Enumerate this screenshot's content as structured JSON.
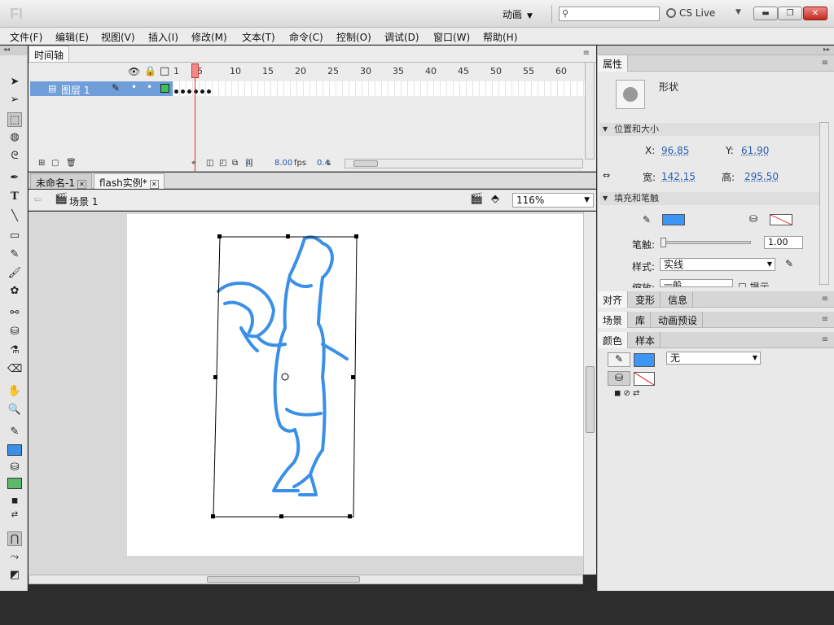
{
  "app": {
    "logo": "Fl",
    "workspace": "动画",
    "search_placeholder": "",
    "cs_live": "CS Live"
  },
  "menu": [
    "文件(F)",
    "编辑(E)",
    "视图(V)",
    "插入(I)",
    "修改(M)",
    "文本(T)",
    "命令(C)",
    "控制(O)",
    "调试(D)",
    "窗口(W)",
    "帮助(H)"
  ],
  "timeline": {
    "tab": "时间轴",
    "layer_name": "图层 1",
    "ruler": [
      "1",
      "5",
      "10",
      "15",
      "20",
      "25",
      "30",
      "35",
      "40",
      "45",
      "50",
      "55",
      "60"
    ],
    "current_frame": "4",
    "fps": "8.00",
    "fps_unit": "fps",
    "time": "0.4",
    "time_unit": "s"
  },
  "document": {
    "tabs": [
      {
        "label": "未命名-1"
      },
      {
        "label": "flash实例*"
      }
    ],
    "scene": "场景 1",
    "zoom": "116%"
  },
  "properties": {
    "tab": "属性",
    "type": "形状",
    "pos_size_header": "位置和大小",
    "x_label": "X:",
    "x": "96.85",
    "y_label": "Y:",
    "y": "61.90",
    "w_label": "宽:",
    "w": "142.15",
    "h_label": "高:",
    "h": "295.50",
    "fill_stroke_header": "填充和笔触",
    "stroke_label": "笔触:",
    "stroke_value": "1.00",
    "style_label": "样式:",
    "style_value": "实线",
    "scale_label": "缩放:",
    "scale_value": "一般",
    "hint_label": "提示",
    "stroke_color": "#3b96f5",
    "fill_color": "none"
  },
  "panels": {
    "row1": [
      "对齐",
      "变形",
      "信息"
    ],
    "row2": [
      "场景",
      "库",
      "动画预设"
    ],
    "row3": [
      "颜色",
      "样本"
    ],
    "color_type": "无"
  },
  "colors": {
    "stroke": "#3a8fe8",
    "tool_fill": "#5ab96a",
    "layer_highlight": "#6f9ed9"
  }
}
